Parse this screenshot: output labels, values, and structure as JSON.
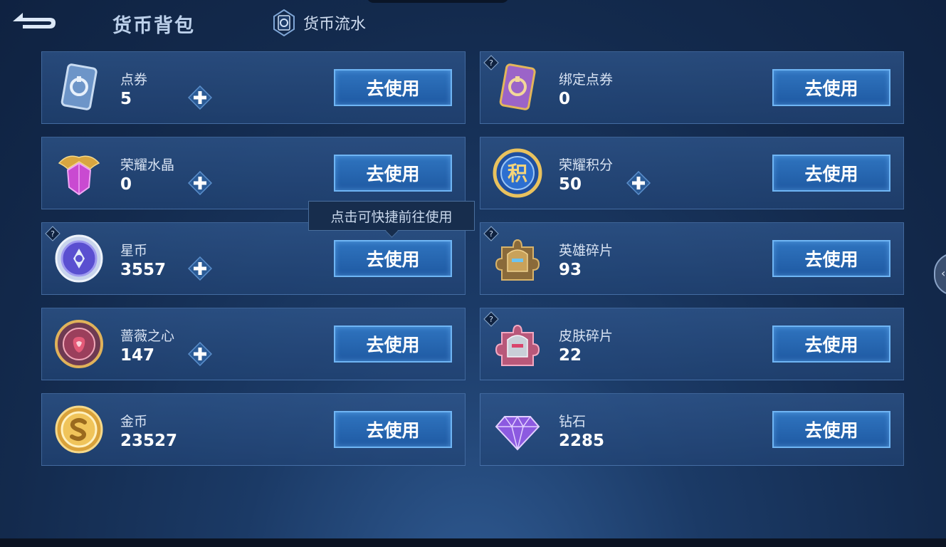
{
  "header": {
    "title": "货币背包",
    "flow_tab_label": "货币流水"
  },
  "tooltip": {
    "text": "点击可快捷前往使用"
  },
  "use_button_label": "去使用",
  "currencies": [
    {
      "name": "点券",
      "amount": "5",
      "icon": "voucher-card-icon"
    },
    {
      "name": "绑定点券",
      "amount": "0",
      "icon": "bound-voucher-card-icon"
    },
    {
      "name": "荣耀水晶",
      "amount": "0",
      "icon": "glory-crystal-icon"
    },
    {
      "name": "荣耀积分",
      "amount": "50",
      "icon": "glory-points-icon"
    },
    {
      "name": "星币",
      "amount": "3557",
      "icon": "star-coin-icon"
    },
    {
      "name": "英雄碎片",
      "amount": "93",
      "icon": "hero-fragment-icon"
    },
    {
      "name": "蔷薇之心",
      "amount": "147",
      "icon": "rose-heart-icon"
    },
    {
      "name": "皮肤碎片",
      "amount": "22",
      "icon": "skin-fragment-icon"
    },
    {
      "name": "金币",
      "amount": "23527",
      "icon": "gold-coin-icon"
    },
    {
      "name": "钻石",
      "amount": "2285",
      "icon": "diamond-icon"
    }
  ],
  "colors": {
    "accent": "#2f74bf",
    "border": "#6fb5f4",
    "background": "#132a4d"
  },
  "glyphs": {
    "points_char": "积",
    "side_arrow": "‹"
  }
}
